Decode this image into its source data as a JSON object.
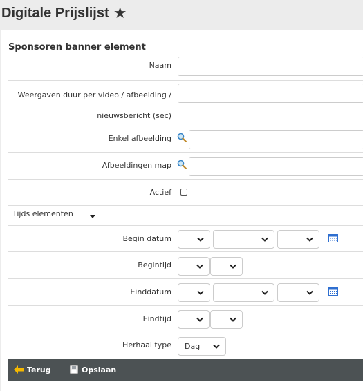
{
  "page": {
    "title": "Digitale Prijslijst",
    "favorite_icon": "star-icon"
  },
  "form": {
    "title": "Sponsoren banner element",
    "name_label": "Naam",
    "name_value": "",
    "duration_label_line1": "Weergaven duur per video / afbeelding /",
    "duration_label_line2": "nieuwsbericht (sec)",
    "duration_value": "",
    "single_image_label": "Enkel afbeelding",
    "single_image_value": "",
    "image_folder_label": "Afbeeldingen map",
    "image_folder_value": "",
    "active_label": "Actief",
    "active_checked": false
  },
  "time_section": {
    "label": "Tijds elementen",
    "start_date_label": "Begin datum",
    "start_time_label": "Begintijd",
    "end_date_label": "Einddatum",
    "end_time_label": "Eindtijd",
    "repeat_label": "Herhaal type",
    "repeat_value": "Dag"
  },
  "footer": {
    "back_label": "Terug",
    "save_label": "Opslaan"
  },
  "colors": {
    "footer_bg": "#4c5254",
    "accent_yellow": "#f5b800",
    "calendar_blue": "#2f6fd0"
  }
}
